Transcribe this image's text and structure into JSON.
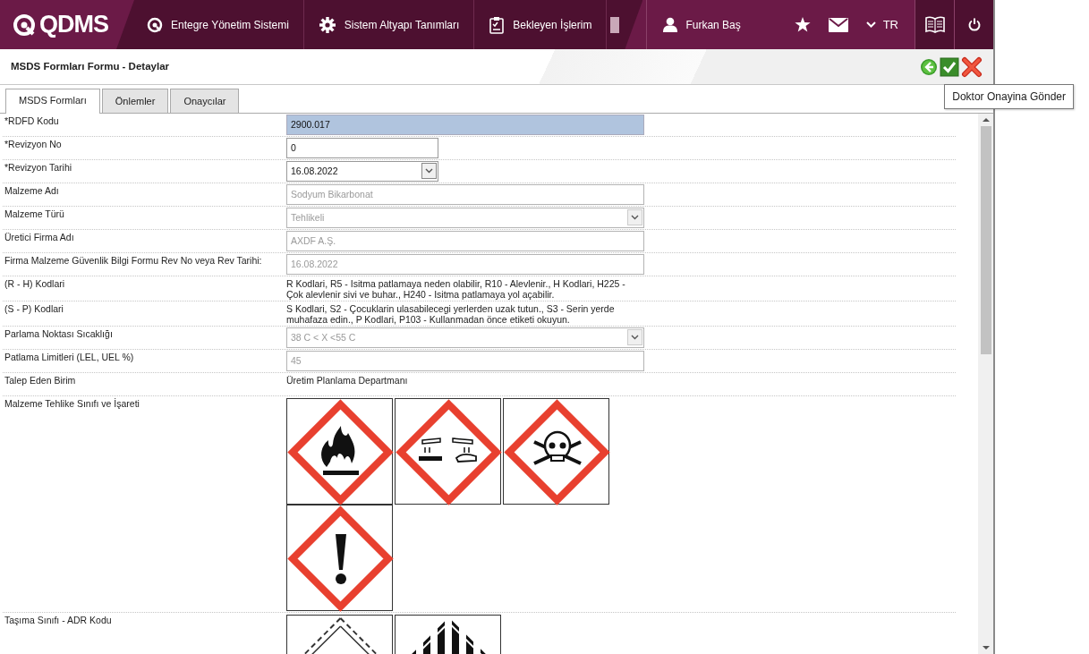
{
  "navbar": {
    "logo": "QDMS",
    "menu": [
      {
        "label": "Entegre Yönetim Sistemi"
      },
      {
        "label": "Sistem Altyapı Tanımları"
      },
      {
        "label": "Bekleyen İşlerim"
      }
    ],
    "user": "Furkan Baş",
    "language": "TR"
  },
  "header": {
    "title": "MSDS Formları Formu - Detaylar",
    "actions": [
      {
        "kind": "back"
      },
      {
        "kind": "approve"
      },
      {
        "kind": "cancel"
      }
    ],
    "tooltip": "Doktor Onayina Gönder"
  },
  "tabs": [
    {
      "label": "MSDS Formları",
      "selected": true
    },
    {
      "label": "Önlemler",
      "selected": false
    },
    {
      "label": "Onaycılar",
      "selected": false
    }
  ],
  "fields": [
    {
      "kind": "input",
      "label": "*RDFD Kodu",
      "value": "2900.017",
      "disabled": false,
      "highlighted": true
    },
    {
      "kind": "short-input",
      "label": "*Revizyon No",
      "value": "0",
      "disabled": false,
      "highlighted": false
    },
    {
      "kind": "date-select",
      "label": "*Revizyon Tarihi",
      "value": "16.08.2022",
      "disabled": false
    },
    {
      "kind": "input",
      "label": "Malzeme Adı",
      "value": "Sodyum Bikarbonat",
      "disabled": true,
      "highlighted": false
    },
    {
      "kind": "select",
      "label": "Malzeme Türü",
      "value": "Tehlikeli",
      "disabled": true
    },
    {
      "kind": "input",
      "label": "Üretici Firma Adı",
      "value": "AXDF A.Ş.",
      "disabled": true,
      "highlighted": false
    },
    {
      "kind": "input",
      "label": "Firma Malzeme Güvenlik Bilgi Formu Rev No veya Rev Tarihi:",
      "value": "16.08.2022",
      "disabled": true,
      "highlighted": false
    },
    {
      "kind": "text",
      "label": "(R - H) Kodlari",
      "value": "R Kodlari, R5 - Isitma patlamaya neden olabilir, R10 - Alevlenir., H Kodlari, H225 - Çok alevlenir sivi ve buhar., H240 - Isitma patlamaya yol açabilir."
    },
    {
      "kind": "text",
      "label": "(S - P) Kodlari",
      "value": "S Kodlari, S2 - Çocuklarin ulasabilecegi yerlerden uzak tutun., S3 - Serin yerde muhafaza edin., P Kodlari, P103 - Kullanmadan önce etiketi okuyun."
    },
    {
      "kind": "select",
      "label": "Parlama Noktası Sıcaklığı",
      "value": "38 C < X <55 C",
      "disabled": true
    },
    {
      "kind": "input",
      "label": "Patlama Limitleri (LEL, UEL %)",
      "value": "45",
      "disabled": true,
      "highlighted": false
    },
    {
      "kind": "text",
      "label": "Talep Eden Birim",
      "value": "Üretim Planlama Departmanı"
    },
    {
      "kind": "pictograms",
      "label": "Malzeme Tehlike Sınıfı ve İşareti",
      "items": [
        {
          "kind": "flame"
        },
        {
          "kind": "corrosion"
        },
        {
          "kind": "skull"
        },
        {
          "kind": "exclamation"
        }
      ]
    },
    {
      "kind": "pictograms",
      "label": "Taşıma Sınıfı - ADR Kodu",
      "items": [
        {
          "kind": "adr-corrosive"
        },
        {
          "kind": "adr-stripes"
        }
      ]
    }
  ]
}
